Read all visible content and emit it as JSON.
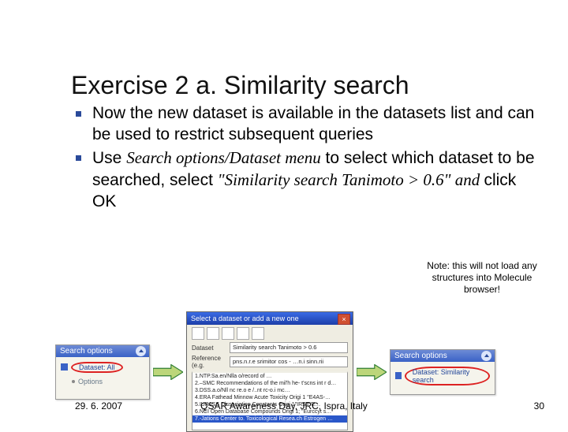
{
  "title": "Exercise 2 a. Similarity search",
  "bullets": [
    {
      "text": "Now the new dataset is available in the datasets list and can be used to restrict subsequent queries"
    },
    {
      "pre": "Use ",
      "em1": "Search options/Dataset menu",
      "mid": " to select which dataset to be searched, select ",
      "em2": "\"Similarity search Tanimoto > 0.6\" and ",
      "post": "click OK"
    }
  ],
  "note": "Note: this will not load any structures into Molecule browser!",
  "panelA": {
    "head": "Search options",
    "item": "Dataset: All",
    "options": "Options"
  },
  "panelC": {
    "head": "Search options",
    "item": "Dataset: Similarity search"
  },
  "dialog": {
    "title": "Select a dataset or add a new one",
    "datasetLabel": "Dataset",
    "datasetValue": "Similarity search Tanimoto > 0.6",
    "refLabel": "Reference (e.g.",
    "refValue": "pns.n.r.e srimitor cos - …n.i sinn.rii",
    "items": [
      "1.NTP.Sa.en/Nlla o/record of …",
      "2.–SMC Recommendations of the mil'h he- t'scns int r d…",
      "3.DSS.a.o/Nll nc re.o e /..nt rc-o.i mc…",
      "4.ERA Fathead Minnow Acute Toxicity Origi 1 \"E4AS-…",
      "5.IUPASS Dissociation Constants Origi 1\"IRST\"E…",
      "6.NCI Open Database Compounds Origi 1; \"Eurccyt s…",
      "7.-Jations Center to. Toxicological Resea.ch Estrogen …"
    ]
  },
  "footer": {
    "date": "29. 6. 2007",
    "center": "QSAR Awareness Day, JRC, Ispra, Italy",
    "page": "30"
  }
}
